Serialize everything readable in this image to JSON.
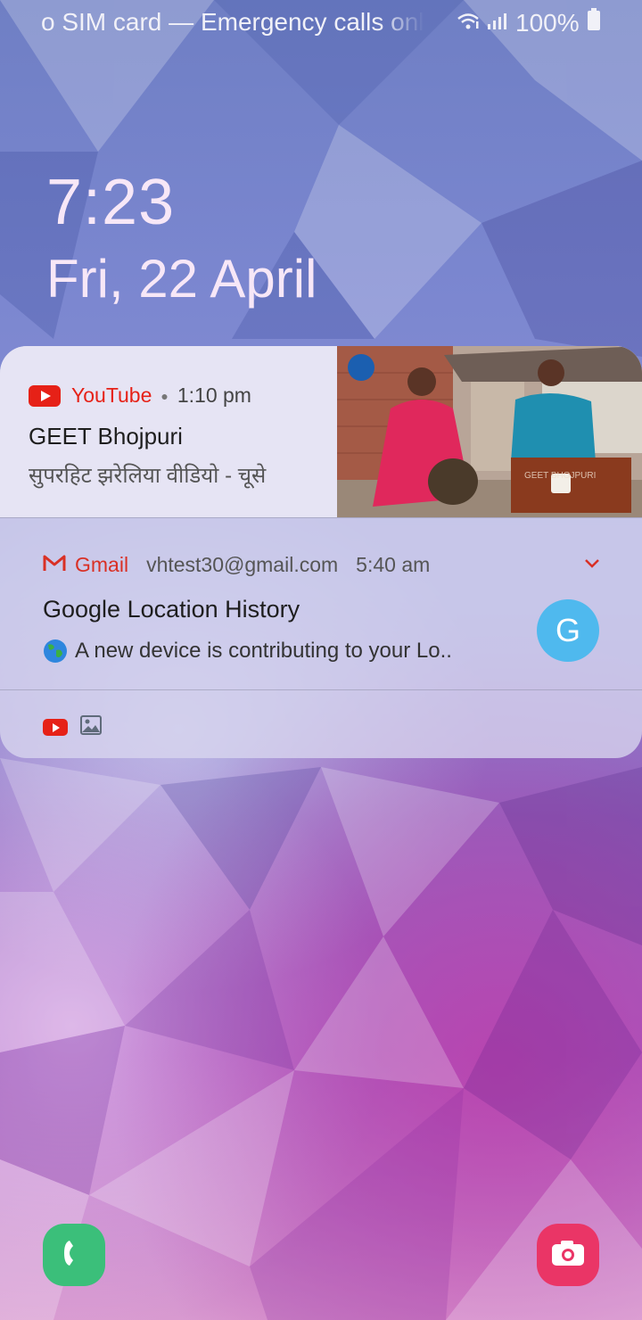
{
  "status_bar": {
    "carrier_text": "o SIM card — Emergency calls only",
    "wifi_icon": "wifi-icon",
    "signal_icon": "signal-icon",
    "battery_percent": "100%",
    "battery_icon": "battery-full-icon"
  },
  "lock_screen": {
    "time": "7:23",
    "date": "Fri, 22 April"
  },
  "notifications": {
    "youtube": {
      "app_name": "YouTube",
      "time": "1:10 pm",
      "title": "GEET Bhojpuri",
      "text": "सुपरहिट झरेलिया वीडियो - चूसे",
      "thumbnail_watermark": "GEET BHOJPURI",
      "accent": "#e62117"
    },
    "gmail": {
      "app_name": "Gmail",
      "account": "vhtest30@gmail.com",
      "time": "5:40 am",
      "title": "Google Location History",
      "text": "A new device is contributing to your Lo..",
      "avatar_letter": "G",
      "accent": "#d93025",
      "avatar_color": "#4fb9ee"
    },
    "summary_icons": [
      "youtube-icon",
      "image-icon"
    ]
  },
  "shortcuts": {
    "left": "phone-icon",
    "right": "camera-icon",
    "phone_color": "#3bbf7a",
    "camera_color": "#ea3566"
  }
}
